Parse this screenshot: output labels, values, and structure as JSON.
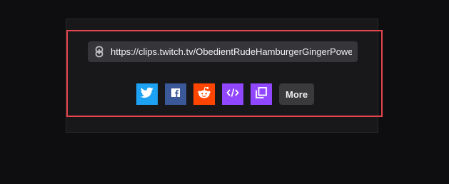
{
  "share": {
    "url": "https://clips.twitch.tv/ObedientRudeHamburgerGingerPower",
    "more_label": "More"
  },
  "buttons": [
    {
      "name": "twitter",
      "icon": "twitter-icon",
      "color": "#1da1f2"
    },
    {
      "name": "facebook",
      "icon": "facebook-icon",
      "color": "#3b5998"
    },
    {
      "name": "reddit",
      "icon": "reddit-icon",
      "color": "#ff4500"
    },
    {
      "name": "embed",
      "icon": "embed-code-icon",
      "color": "#9147ff"
    },
    {
      "name": "copy",
      "icon": "copy-icon",
      "color": "#9147ff"
    }
  ],
  "colors": {
    "background": "#0e0e10",
    "panel": "#18181b",
    "highlight": "#e5454d",
    "url_bar": "#36363a"
  }
}
